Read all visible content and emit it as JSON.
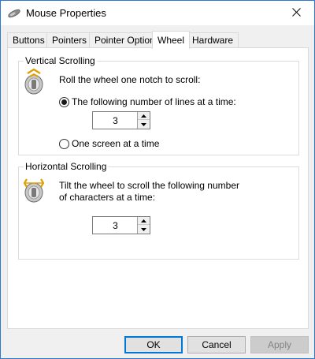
{
  "window": {
    "title": "Mouse Properties",
    "icon": "mouse-icon",
    "close_icon": "close-icon"
  },
  "tabs": [
    {
      "label": "Buttons",
      "active": false
    },
    {
      "label": "Pointers",
      "active": false
    },
    {
      "label": "Pointer Options",
      "active": false
    },
    {
      "label": "Wheel",
      "active": true
    },
    {
      "label": "Hardware",
      "active": false
    }
  ],
  "vertical": {
    "title": "Vertical Scrolling",
    "instruction": "Roll the wheel one notch to scroll:",
    "option_lines": "The following number of lines at a time:",
    "option_screen": "One screen at a time",
    "selected": "lines",
    "lines_value": "3"
  },
  "horizontal": {
    "title": "Horizontal Scrolling",
    "instruction_line1": "Tilt the wheel to scroll the following number",
    "instruction_line2": "of characters at a time:",
    "chars_value": "3"
  },
  "buttons": {
    "ok": "OK",
    "cancel": "Cancel",
    "apply": "Apply"
  },
  "colors": {
    "accent": "#0078d7",
    "window_border": "#2b79d0"
  }
}
